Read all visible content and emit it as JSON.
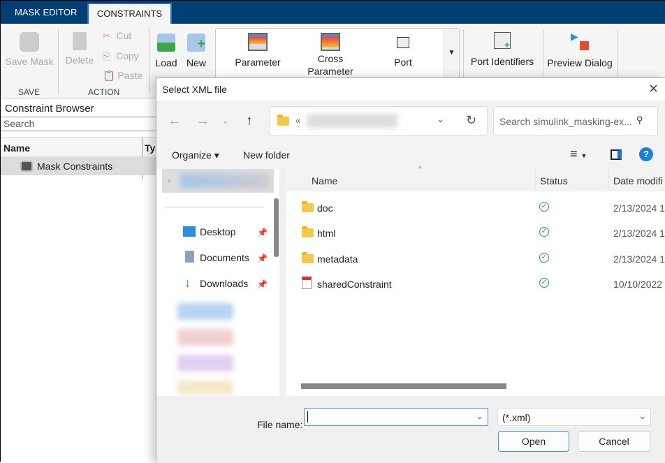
{
  "tabs": {
    "mask_editor": "MASK EDITOR",
    "constraints": "CONSTRAINTS"
  },
  "ribbon": {
    "save_mask": "Save Mask",
    "delete": "Delete",
    "cut": "Cut",
    "copy": "Copy",
    "paste": "Paste",
    "load": "Load",
    "new": "New",
    "parameter": "Parameter",
    "cross_parameter": "Cross Parameter",
    "port": "Port",
    "port_identifiers": "Port Identifiers",
    "preview_dialog": "Preview Dialog",
    "sections": {
      "save": "SAVE",
      "action": "ACTION"
    }
  },
  "browser": {
    "title": "Constraint Browser",
    "search_placeholder": "Search",
    "col_name": "Name",
    "col_type": "Ty",
    "items": [
      {
        "label": "Mask Constraints"
      }
    ]
  },
  "dialog": {
    "title": "Select XML file",
    "address_prefix": "«",
    "search_placeholder": "Search simulink_masking-ex...",
    "organize": "Organize ▾",
    "new_folder": "New folder",
    "nav": [
      {
        "label": "Desktop"
      },
      {
        "label": "Documents"
      },
      {
        "label": "Downloads"
      }
    ],
    "columns": {
      "name": "Name",
      "status": "Status",
      "date": "Date modifi"
    },
    "files": [
      {
        "name": "doc",
        "type": "folder",
        "date": "2/13/2024 1"
      },
      {
        "name": "html",
        "type": "folder",
        "date": "2/13/2024 1"
      },
      {
        "name": "metadata",
        "type": "folder",
        "date": "2/13/2024 1"
      },
      {
        "name": "sharedConstraint",
        "type": "xml",
        "date": "10/10/2022"
      }
    ],
    "file_name_label": "File name:",
    "file_name_value": "",
    "file_type": "(*.xml)",
    "open": "Open",
    "cancel": "Cancel"
  },
  "colors": {
    "tabbar": "#003f74",
    "accent": "#1c6fd1",
    "status_ok": "#2e9a44"
  }
}
